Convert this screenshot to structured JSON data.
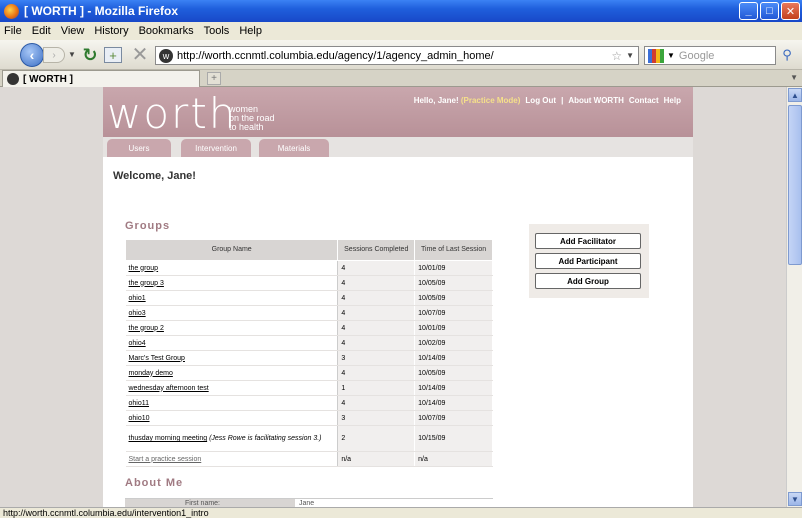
{
  "window": {
    "title": "[ WORTH ] - Mozilla Firefox"
  },
  "menu": [
    "File",
    "Edit",
    "View",
    "History",
    "Bookmarks",
    "Tools",
    "Help"
  ],
  "browser": {
    "url": "http://worth.ccnmtl.columbia.edu/agency/1/agency_admin_home/",
    "search_placeholder": "Google",
    "tab_title": "[ WORTH ]"
  },
  "status_text": "http://worth.ccnmtl.columbia.edu/intervention1_intro",
  "site": {
    "logo": "worth",
    "tagline": [
      "women",
      "on the road",
      "to health"
    ],
    "greeting": "Hello, Jane!",
    "practice_mode": "(Practice Mode)",
    "links": [
      "Log Out",
      "|",
      "About WORTH",
      "Contact",
      "Help"
    ],
    "tabs": [
      "Users",
      "Intervention",
      "Materials"
    ]
  },
  "welcome": "Welcome, Jane!",
  "groups": {
    "title": "Groups",
    "headers": [
      "Group Name",
      "Sessions Completed",
      "Time of Last Session"
    ],
    "rows": [
      {
        "name": "the group",
        "note": "",
        "sessions": "4",
        "last": "10/01/09"
      },
      {
        "name": "the group 3",
        "note": "",
        "sessions": "4",
        "last": "10/05/09"
      },
      {
        "name": "ohio1",
        "note": "",
        "sessions": "4",
        "last": "10/05/09"
      },
      {
        "name": "ohio3",
        "note": "",
        "sessions": "4",
        "last": "10/07/09"
      },
      {
        "name": "the group 2",
        "note": "",
        "sessions": "4",
        "last": "10/01/09"
      },
      {
        "name": "ohio4",
        "note": "",
        "sessions": "4",
        "last": "10/02/09"
      },
      {
        "name": "Marc's Test Group",
        "note": "",
        "sessions": "3",
        "last": "10/14/09"
      },
      {
        "name": "monday demo",
        "note": "",
        "sessions": "4",
        "last": "10/05/09"
      },
      {
        "name": "wednesday afternoon test",
        "note": "",
        "sessions": "1",
        "last": "10/14/09"
      },
      {
        "name": "ohio11",
        "note": "",
        "sessions": "4",
        "last": "10/14/09"
      },
      {
        "name": "ohio10",
        "note": "",
        "sessions": "3",
        "last": "10/07/09"
      },
      {
        "name": "thusday morning meeting",
        "note": "(Jess Rowe is facilitating session 3.)",
        "sessions": "2",
        "last": "10/15/09"
      }
    ],
    "practice": {
      "label": "Start a practice session",
      "sessions": "n/a",
      "last": "n/a"
    }
  },
  "actions": [
    "Add Facilitator",
    "Add Participant",
    "Add Group"
  ],
  "about": {
    "title": "About Me",
    "first_name_label": "First name:",
    "first_name_value": "Jane"
  }
}
